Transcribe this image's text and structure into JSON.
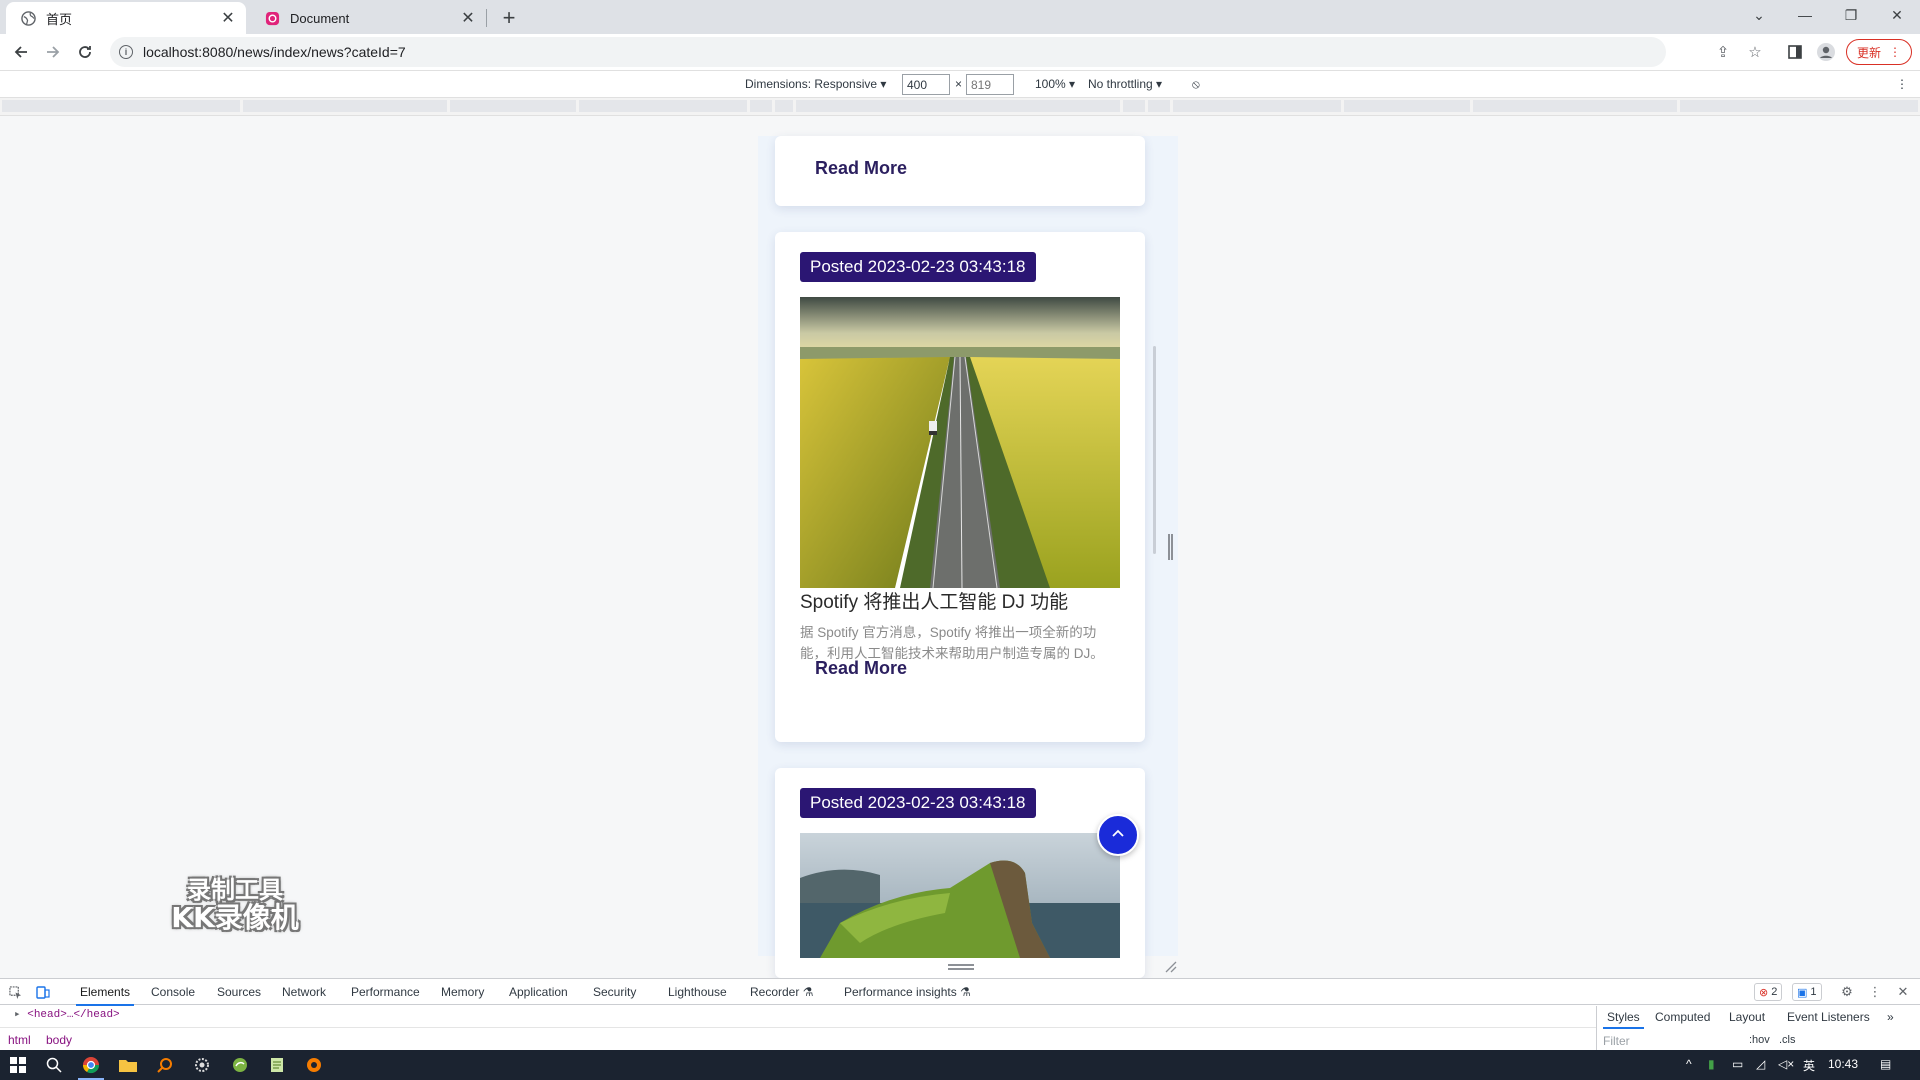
{
  "browser": {
    "tabs": [
      {
        "title": "首页",
        "active": true,
        "icon": "globe-icon"
      },
      {
        "title": "Document",
        "active": false,
        "icon": "app-favicon-icon"
      }
    ],
    "url": "localhost:8080/news/index/news?cateId=7",
    "update_label": "更新"
  },
  "device_toolbar": {
    "dimensions_label": "Dimensions: Responsive",
    "width": "400",
    "height": "819",
    "zoom": "100%",
    "throttling": "No throttling",
    "times": "×"
  },
  "page": {
    "cards": [
      {
        "read_more": "Read More"
      },
      {
        "posted": "Posted 2023-02-23 03:43:18",
        "image": "road-through-rapeseed-fields",
        "title": "Spotify 将推出人工智能 DJ 功能",
        "excerpt": "据 Spotify 官方消息，Spotify 将推出一项全新的功能，利用人工智能技术来帮助用户制造专属的 DJ。",
        "read_more": "Read More"
      },
      {
        "posted": "Posted 2023-02-23 03:43:18",
        "image": "coastal-cliff-landscape"
      }
    ],
    "back_to_top_icon": "chevron-up-icon"
  },
  "watermark": {
    "line1": "录制工具",
    "line2": "KK录像机"
  },
  "devtools": {
    "tabs": [
      "Elements",
      "Console",
      "Sources",
      "Network",
      "Performance",
      "Memory",
      "Application",
      "Security",
      "Lighthouse",
      "Recorder",
      "Performance insights"
    ],
    "active_tab": "Elements",
    "error_count": "2",
    "message_count": "1",
    "source_line": "<head>…</head>",
    "breadcrumbs": [
      "html",
      "body"
    ],
    "side_tabs": [
      "Styles",
      "Computed",
      "Layout",
      "Event Listeners"
    ],
    "filter_placeholder": "Filter",
    "hov": ":hov",
    "cls": ".cls"
  },
  "taskbar": {
    "time": "10:43",
    "ime": "英"
  },
  "colors": {
    "posted_bg": "#2b1673",
    "read_more": "#2b1f5f",
    "back_to_top": "#1a2bd9",
    "page_bg": "#eef4fb"
  }
}
